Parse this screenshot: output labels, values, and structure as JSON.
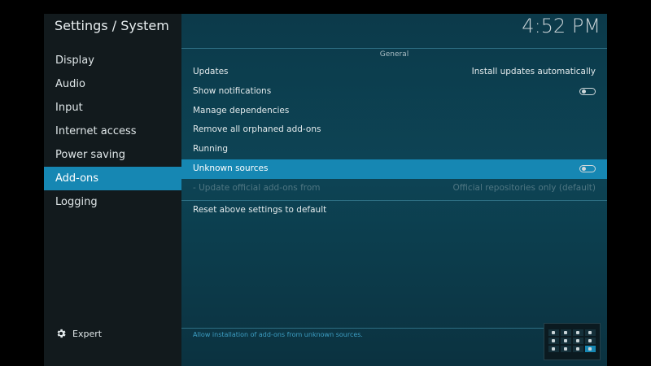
{
  "window": {
    "title": "Settings / System"
  },
  "clock": {
    "time": "4:52 PM"
  },
  "sidebar": {
    "items": [
      {
        "label": "Display",
        "active": false
      },
      {
        "label": "Audio",
        "active": false
      },
      {
        "label": "Input",
        "active": false
      },
      {
        "label": "Internet access",
        "active": false
      },
      {
        "label": "Power saving",
        "active": false
      },
      {
        "label": "Add-ons",
        "active": true
      },
      {
        "label": "Logging",
        "active": false
      }
    ],
    "expert_label": "Expert",
    "expert_icon": "gear-icon"
  },
  "main": {
    "group_title": "General",
    "settings": [
      {
        "label": "Updates",
        "value": "Install updates automatically"
      },
      {
        "label": "Show notifications",
        "toggle": "off"
      },
      {
        "label": "Manage dependencies"
      },
      {
        "label": "Remove all orphaned add-ons"
      },
      {
        "label": "Running"
      },
      {
        "label": "Unknown sources",
        "toggle": "off",
        "selected": true
      },
      {
        "label": "- Update official add-ons from",
        "value": "Official repositories only (default)",
        "disabled": true
      }
    ],
    "reset_label": "Reset above settings to default",
    "help_text": "Allow installation of add-ons from unknown sources."
  },
  "colors": {
    "accent": "#1687b3",
    "sidebar_bg": "#121a1d",
    "main_bg": "#0c3a4a",
    "help_text": "#3d9ec4"
  }
}
